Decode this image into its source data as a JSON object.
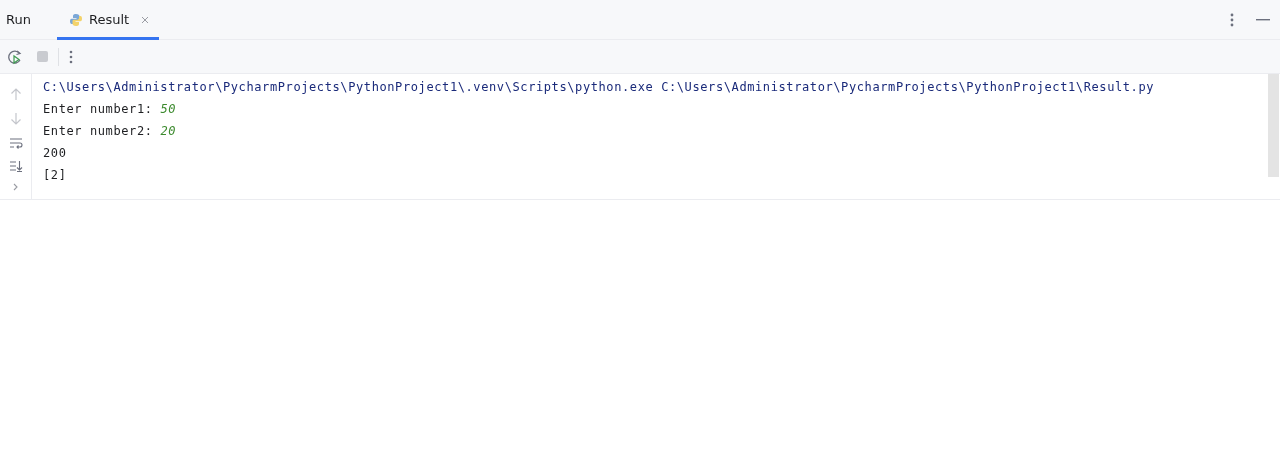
{
  "panel": {
    "title": "Run"
  },
  "tabs": [
    {
      "label": "Result",
      "selected": true
    }
  ],
  "console": {
    "lines": [
      {
        "kind": "command",
        "text": "C:\\Users\\Administrator\\PycharmProjects\\PythonProject1\\.venv\\Scripts\\python.exe C:\\Users\\Administrator\\PycharmProjects\\PythonProject1\\Result.py"
      },
      {
        "kind": "prompt",
        "text": "Enter number1: ",
        "input": "50"
      },
      {
        "kind": "prompt",
        "text": "Enter number2: ",
        "input": "20"
      },
      {
        "kind": "output",
        "text": "200"
      },
      {
        "kind": "output",
        "text": "[2]"
      }
    ]
  }
}
